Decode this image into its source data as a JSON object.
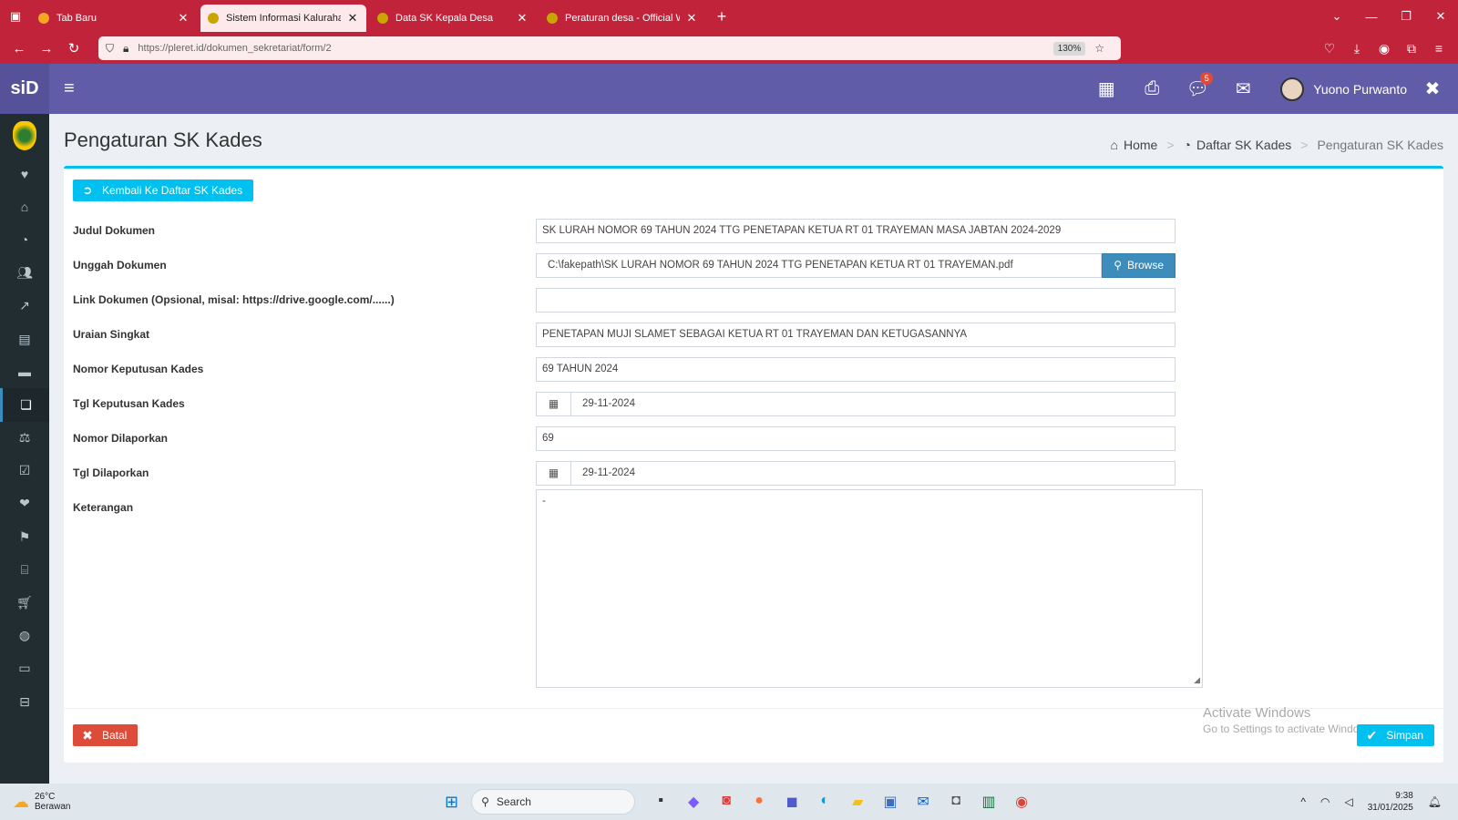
{
  "browser": {
    "tabs": [
      {
        "label": "Tab Baru",
        "active": false,
        "color": "#f5a623"
      },
      {
        "label": "Sistem Informasi Kalurahan Pleret",
        "active": true,
        "color": "#f9c800"
      },
      {
        "label": "Data SK Kepala Desa",
        "active": false,
        "color": "#f9c800"
      },
      {
        "label": "Peraturan desa - Official Website",
        "active": false,
        "color": "#f9c800"
      }
    ],
    "url": "https://pleret.id/dokumen_sekretariat/form/2",
    "zoom": "130%"
  },
  "app": {
    "logo": "siD",
    "notification_count": "5",
    "user_name": "Yuono Purwanto"
  },
  "page": {
    "title": "Pengaturan SK Kades",
    "breadcrumb": {
      "home": "Home",
      "list": "Daftar SK Kades",
      "current": "Pengaturan SK Kades"
    },
    "back_button": "Kembali Ke Daftar SK Kades"
  },
  "form": {
    "judul_label": "Judul Dokumen",
    "judul_value": "SK LURAH NOMOR 69 TAHUN 2024 TTG PENETAPAN KETUA RT 01 TRAYEMAN MASA JABTAN 2024-2029",
    "unggah_label": "Unggah Dokumen",
    "unggah_value": "C:\\fakepath\\SK LURAH NOMOR 69 TAHUN 2024 TTG PENETAPAN KETUA RT 01 TRAYEMAN.pdf",
    "browse_label": "Browse",
    "link_label": "Link Dokumen (Opsional, misal: https://drive.google.com/......)",
    "link_value": "",
    "uraian_label": "Uraian Singkat",
    "uraian_value": "PENETAPAN MUJI SLAMET SEBAGAI KETUA RT 01 TRAYEMAN DAN KETUGASANNYA",
    "nomor_kep_label": "Nomor Keputusan Kades",
    "nomor_kep_value": "69 TAHUN 2024",
    "tgl_kep_label": "Tgl Keputusan Kades",
    "tgl_kep_value": "29-11-2024",
    "nomor_lap_label": "Nomor Dilaporkan",
    "nomor_lap_value": "69",
    "tgl_lap_label": "Tgl Dilaporkan",
    "tgl_lap_value": "29-11-2024",
    "keterangan_label": "Keterangan",
    "keterangan_value": "-",
    "cancel_label": "Batal",
    "save_label": "Simpan"
  },
  "watermark": {
    "line1": "Activate Windows",
    "line2": "Go to Settings to activate Windows."
  },
  "taskbar": {
    "temperature": "26°C",
    "weather": "Berawan",
    "search_placeholder": "Search",
    "time": "9:38",
    "date": "31/01/2025"
  }
}
